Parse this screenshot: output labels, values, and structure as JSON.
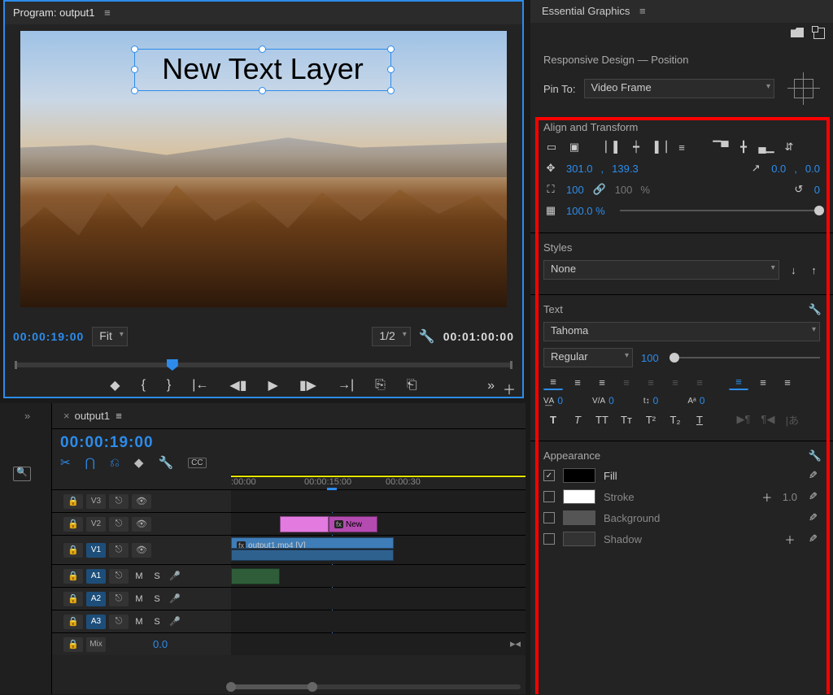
{
  "program": {
    "title_prefix": "Program:",
    "sequence_name": "output1",
    "text_layer": "New Text Layer",
    "current_tc": "00:00:19:00",
    "zoom": "Fit",
    "resolution": "1/2",
    "duration_tc": "00:01:00:00"
  },
  "timeline": {
    "tab_name": "output1",
    "current_tc": "00:00:19:00",
    "ruler": {
      "t0": ":00:00",
      "t1": "00:00:15:00",
      "t2": "00:00:30"
    },
    "tracks": {
      "v3": "V3",
      "v2": "V2",
      "v1": "V1",
      "a1": "A1",
      "a2": "A2",
      "a3": "A3",
      "mix": "Mix",
      "mix_db": "0.0"
    },
    "clips": {
      "graphic_label": "New",
      "video_label": "output1.mp4 [V]"
    },
    "solo": "S"
  },
  "eg": {
    "panel_title": "Essential Graphics",
    "responsive": {
      "header": "Responsive Design — Position",
      "pin_label": "Pin To:",
      "pin_target": "Video Frame"
    },
    "align": {
      "header": "Align and Transform",
      "pos_x": "301.0",
      "pos_y": "139.3",
      "anchor_x": "0.0",
      "anchor_y": "0.0",
      "scale": "100",
      "scale_linked": "100",
      "pct": "%",
      "rotation": "0",
      "opacity": "100.0 %"
    },
    "styles": {
      "header": "Styles",
      "value": "None"
    },
    "text": {
      "header": "Text",
      "font": "Tahoma",
      "weight": "Regular",
      "size": "100",
      "tracking": "0",
      "kerning": "0",
      "leading": "0",
      "baseline": "0"
    },
    "appearance": {
      "header": "Appearance",
      "fill": "Fill",
      "stroke": "Stroke",
      "stroke_w": "1.0",
      "background": "Background",
      "shadow": "Shadow"
    }
  }
}
